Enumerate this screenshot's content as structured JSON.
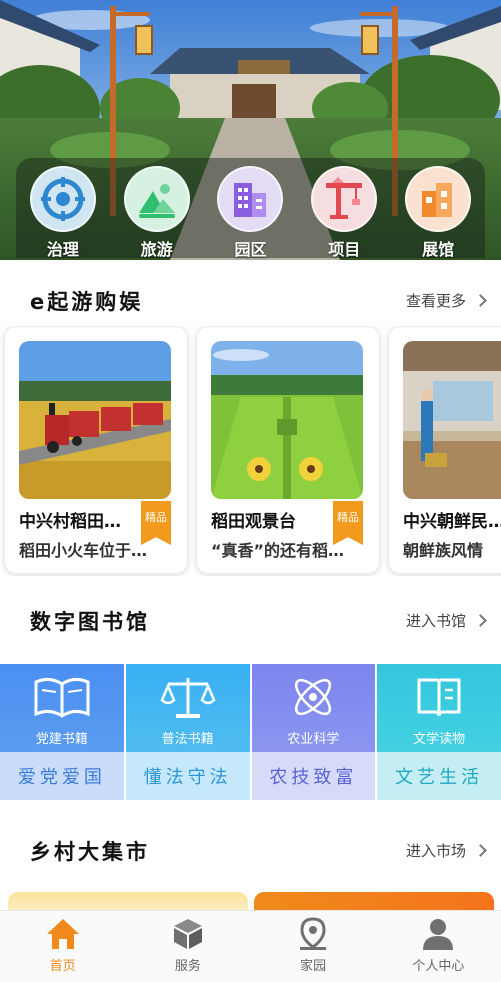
{
  "quick_nav": [
    {
      "label": "治理",
      "icon": "target-icon"
    },
    {
      "label": "旅游",
      "icon": "mountain-icon"
    },
    {
      "label": "园区",
      "icon": "buildings-icon"
    },
    {
      "label": "项目",
      "icon": "crane-icon"
    },
    {
      "label": "展馆",
      "icon": "museum-icon"
    }
  ],
  "travel": {
    "title": "e起游购娱",
    "more": "查看更多",
    "cards": [
      {
        "title": "中兴村稻田…",
        "desc": "稻田小火车位于…",
        "badge": "精品"
      },
      {
        "title": "稻田观景台",
        "desc": "“真香”的还有稻…",
        "badge": "精品"
      },
      {
        "title": "中兴朝鲜民…",
        "desc": "朝鲜族风情",
        "badge": ""
      }
    ]
  },
  "library": {
    "title": "数字图书馆",
    "more": "进入书馆",
    "tiles": [
      {
        "label": "党建书籍",
        "slogan": "爱党爱国",
        "icon": "book-open-icon",
        "color": "#4a8ef0"
      },
      {
        "label": "普法书籍",
        "slogan": "懂法守法",
        "icon": "scales-icon",
        "color": "#3fb2ef"
      },
      {
        "label": "农业科学",
        "slogan": "农技致富",
        "icon": "atom-icon",
        "color": "#7a86ee"
      },
      {
        "label": "文学读物",
        "slogan": "文艺生活",
        "icon": "book-icon",
        "color": "#37cbe0"
      }
    ]
  },
  "market": {
    "title": "乡村大集市",
    "more": "进入市场"
  },
  "tabbar": [
    {
      "label": "首页",
      "icon": "home-icon",
      "active": true
    },
    {
      "label": "服务",
      "icon": "cube-icon",
      "active": false
    },
    {
      "label": "家园",
      "icon": "location-pin-icon",
      "active": false
    },
    {
      "label": "个人中心",
      "icon": "user-icon",
      "active": false
    }
  ],
  "colors": {
    "accent": "#f08a1c",
    "badge": "#f29a1d"
  }
}
